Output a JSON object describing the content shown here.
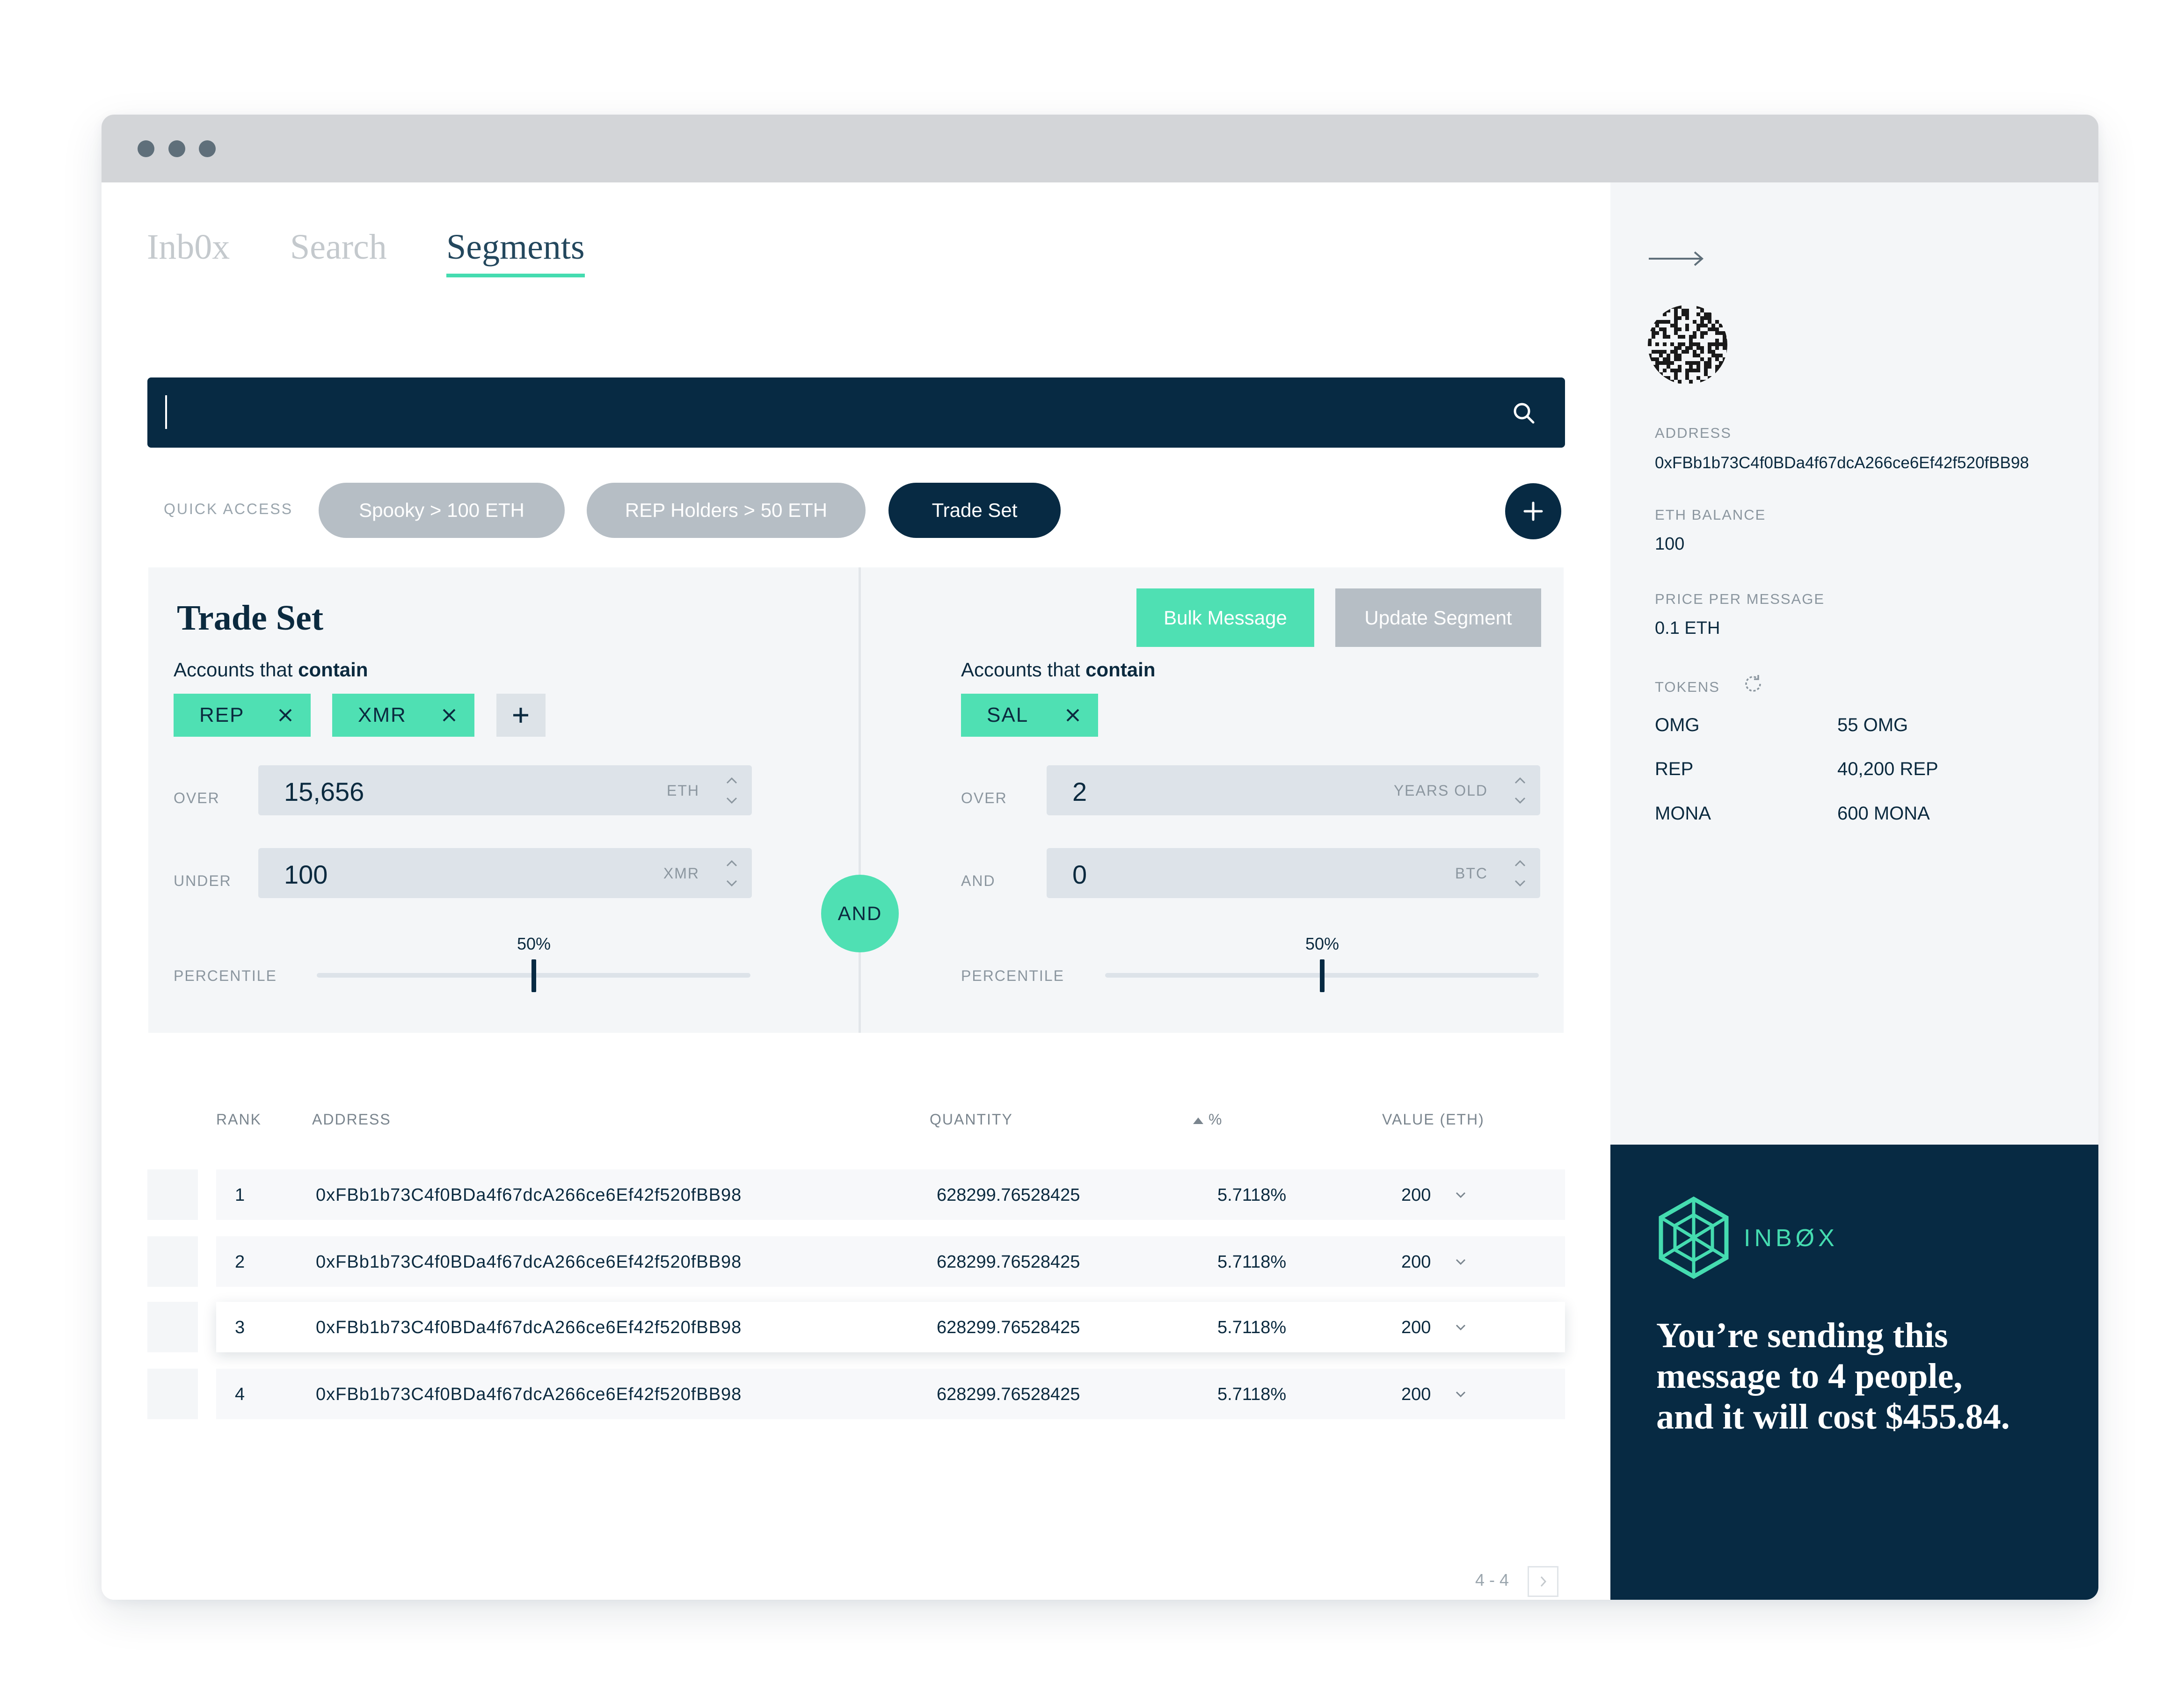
{
  "window": {
    "controls": [
      "close",
      "minimize",
      "maximize"
    ]
  },
  "tabs": [
    {
      "label": "Inb0x"
    },
    {
      "label": "Search"
    },
    {
      "label": "Segments",
      "active": true
    }
  ],
  "search": {
    "value": "",
    "placeholder": "",
    "icon": "search-icon"
  },
  "quick_access": {
    "label": "QUICK ACCESS",
    "chips": [
      {
        "label": "Spooky > 100 ETH",
        "active": false
      },
      {
        "label": "REP Holders > 50 ETH",
        "active": false
      },
      {
        "label": "Trade Set",
        "active": true
      }
    ],
    "add_icon": "plus-icon"
  },
  "segment": {
    "title": "Trade Set",
    "actions": {
      "bulk_message": "Bulk Message",
      "update_segment": "Update Segment"
    },
    "connector": "AND",
    "left": {
      "accounts_prefix": "Accounts that ",
      "accounts_bold": "contain",
      "tags": [
        "REP",
        "XMR"
      ],
      "add_tag_icon": "plus-icon",
      "fields": [
        {
          "label": "OVER",
          "value": "15,656",
          "unit": "ETH"
        },
        {
          "label": "UNDER",
          "value": "100",
          "unit": "XMR"
        }
      ],
      "percentile": {
        "label": "PERCENTILE",
        "value": "50%",
        "fraction": 0.5
      }
    },
    "right": {
      "accounts_prefix": "Accounts that ",
      "accounts_bold": "contain",
      "tags": [
        "SAL"
      ],
      "fields": [
        {
          "label": "OVER",
          "value": "2",
          "unit": "YEARS OLD"
        },
        {
          "label": "AND",
          "value": "0",
          "unit": "BTC"
        }
      ],
      "percentile": {
        "label": "PERCENTILE",
        "value": "50%",
        "fraction": 0.5
      }
    }
  },
  "table": {
    "columns": {
      "rank": "RANK",
      "address": "ADDRESS",
      "quantity": "QUANTITY",
      "percent": "%",
      "value": "VALUE (ETH)"
    },
    "sort": {
      "column": "percent",
      "direction": "asc"
    },
    "rows": [
      {
        "rank": "1",
        "address": "0xFBb1b73C4f0BDa4f67dcA266ce6Ef42f520fBB98",
        "quantity": "628299.76528425",
        "percent": "5.7118%",
        "value": "200"
      },
      {
        "rank": "2",
        "address": "0xFBb1b73C4f0BDa4f67dcA266ce6Ef42f520fBB98",
        "quantity": "628299.76528425",
        "percent": "5.7118%",
        "value": "200"
      },
      {
        "rank": "3",
        "address": "0xFBb1b73C4f0BDa4f67dcA266ce6Ef42f520fBB98",
        "quantity": "628299.76528425",
        "percent": "5.7118%",
        "value": "200",
        "selected": true
      },
      {
        "rank": "4",
        "address": "0xFBb1b73C4f0BDa4f67dcA266ce6Ef42f520fBB98",
        "quantity": "628299.76528425",
        "percent": "5.7118%",
        "value": "200"
      }
    ],
    "pagination": {
      "text": "4 - 4"
    }
  },
  "sidebar": {
    "back_icon": "arrow-right-icon",
    "avatar": "identicon-avatar",
    "address_label": "ADDRESS",
    "address": "0xFBb1b73C4f0BDa4f67dcA266ce6Ef42f520fBB98",
    "eth_balance_label": "ETH BALANCE",
    "eth_balance": "100",
    "price_label": "PRICE PER MESSAGE",
    "price": "0.1 ETH",
    "tokens_label": "TOKENS",
    "tokens": [
      {
        "symbol": "OMG",
        "amount": "55 OMG"
      },
      {
        "symbol": "REP",
        "amount": "40,200 REP"
      },
      {
        "symbol": "MONA",
        "amount": "600 MONA"
      }
    ]
  },
  "summary": {
    "brand": "INBØX",
    "message": "You’re sending this message to 4 people, and it will cost $455.84."
  },
  "colors": {
    "navy": "#072a43",
    "mint": "#4fe0b3",
    "muted_chip": "#b6bec5",
    "panel_bg": "#f4f6f8",
    "titlebar": "#d3d5d8"
  }
}
